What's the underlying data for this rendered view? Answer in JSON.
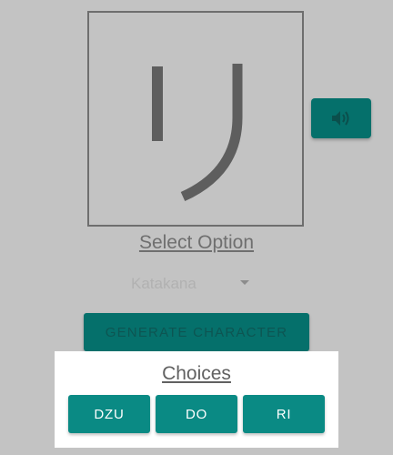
{
  "character_display": {
    "glyph": "リ"
  },
  "speaker_button": {
    "icon": "speaker-icon"
  },
  "select_option": {
    "title": "Select Option"
  },
  "script_dropdown": {
    "selected": "Katakana"
  },
  "generate_button": {
    "label": "GENERATE CHARACTER"
  },
  "choices": {
    "title": "Choices",
    "options": [
      "DZU",
      "DO",
      "RI"
    ]
  },
  "colors": {
    "accent": "#0a8a84",
    "dimmed_accent": "#05706b",
    "overlay_background": "#c3c3c3",
    "panel_background": "#ffffff"
  }
}
